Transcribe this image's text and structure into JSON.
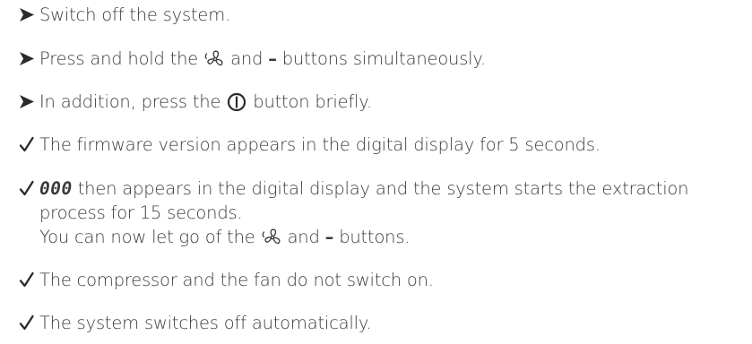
{
  "steps": [
    {
      "marker": "arrow",
      "parts": {
        "a": "Switch off the system."
      }
    },
    {
      "marker": "arrow",
      "parts": {
        "a": "Press and hold the",
        "b": "and",
        "minus": "–",
        "c": "buttons simultaneously."
      }
    },
    {
      "marker": "arrow",
      "parts": {
        "a": "In addition, press the",
        "b": "button briefly."
      }
    },
    {
      "marker": "check",
      "parts": {
        "a": "The firmware version appears in the digital display for 5 seconds."
      }
    },
    {
      "marker": "check",
      "parts": {
        "digits": "000",
        "a": "then appears in the digital display and the system starts the extraction",
        "l2": "process for 15 seconds.",
        "l3a": "You can now let go of the",
        "l3b": "and",
        "minus": "–",
        "l3c": "buttons."
      }
    },
    {
      "marker": "check",
      "parts": {
        "a": "The compressor and the fan do not switch on."
      }
    },
    {
      "marker": "check",
      "parts": {
        "a": "The system switches off automatically."
      }
    }
  ],
  "icons": {
    "arrow": "arrow-bullet-icon",
    "check": "check-bullet-icon",
    "fan": "fan-icon",
    "power": "power-icon"
  },
  "colors": {
    "text": "#3a3a3a"
  }
}
